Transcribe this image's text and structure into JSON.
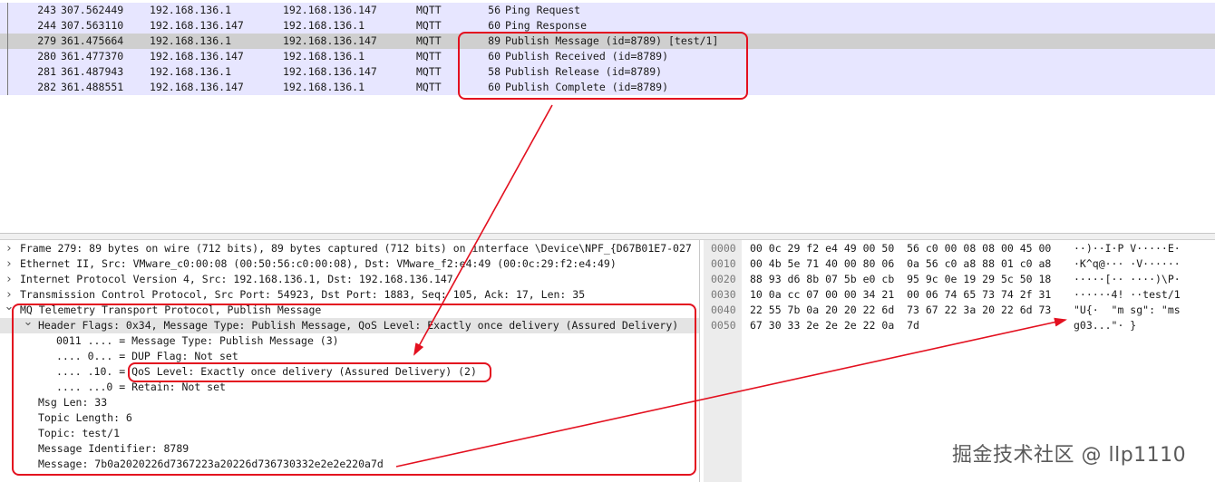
{
  "packets": [
    {
      "no": "243",
      "time": "307.562449",
      "src": "192.168.136.1",
      "dst": "192.168.136.147",
      "protocol": "MQTT",
      "length": "56",
      "info": "Ping Request",
      "selected": false
    },
    {
      "no": "244",
      "time": "307.563110",
      "src": "192.168.136.147",
      "dst": "192.168.136.1",
      "protocol": "MQTT",
      "length": "60",
      "info": "Ping Response",
      "selected": false
    },
    {
      "no": "279",
      "time": "361.475664",
      "src": "192.168.136.1",
      "dst": "192.168.136.147",
      "protocol": "MQTT",
      "length": "89",
      "info": "Publish Message (id=8789) [test/1]",
      "selected": true
    },
    {
      "no": "280",
      "time": "361.477370",
      "src": "192.168.136.147",
      "dst": "192.168.136.1",
      "protocol": "MQTT",
      "length": "60",
      "info": "Publish Received (id=8789)",
      "selected": false
    },
    {
      "no": "281",
      "time": "361.487943",
      "src": "192.168.136.1",
      "dst": "192.168.136.147",
      "protocol": "MQTT",
      "length": "58",
      "info": "Publish Release (id=8789)",
      "selected": false
    },
    {
      "no": "282",
      "time": "361.488551",
      "src": "192.168.136.147",
      "dst": "192.168.136.1",
      "protocol": "MQTT",
      "length": "60",
      "info": "Publish Complete (id=8789)",
      "selected": false
    }
  ],
  "details": [
    {
      "arrow": "collapsed",
      "text": "Frame 279: 89 bytes on wire (712 bits), 89 bytes captured (712 bits) on interface \\Device\\NPF_{D67B01E7-027"
    },
    {
      "arrow": "collapsed",
      "text": "Ethernet II, Src: VMware_c0:00:08 (00:50:56:c0:00:08), Dst: VMware_f2:e4:49 (00:0c:29:f2:e4:49)"
    },
    {
      "arrow": "collapsed",
      "text": "Internet Protocol Version 4, Src: 192.168.136.1, Dst: 192.168.136.147"
    },
    {
      "arrow": "collapsed",
      "text": "Transmission Control Protocol, Src Port: 54923, Dst Port: 1883, Seq: 105, Ack: 17, Len: 35"
    },
    {
      "arrow": "expanded",
      "text": "MQ Telemetry Transport Protocol, Publish Message"
    },
    {
      "arrow": "expanded",
      "text": "Header Flags: 0x34, Message Type: Publish Message, QoS Level: Exactly once delivery (Assured Delivery)",
      "highlight": true
    },
    {
      "arrow": "none",
      "text": "0011 .... = Message Type: Publish Message (3)"
    },
    {
      "arrow": "none",
      "text": ".... 0... = DUP Flag: Not set"
    },
    {
      "arrow": "none",
      "text": ".... .10. = QoS Level: Exactly once delivery (Assured Delivery) (2)"
    },
    {
      "arrow": "none",
      "text": ".... ...0 = Retain: Not set"
    },
    {
      "arrow": "none",
      "text": "Msg Len: 33"
    },
    {
      "arrow": "none",
      "text": "Topic Length: 6"
    },
    {
      "arrow": "none",
      "text": "Topic: test/1"
    },
    {
      "arrow": "none",
      "text": "Message Identifier: 8789"
    },
    {
      "arrow": "none",
      "text": "Message: 7b0a2020226d7367223a20226d736730332e2e2e220a7d"
    }
  ],
  "hex": [
    {
      "offset": "0000",
      "bytes": "00 0c 29 f2 e4 49 00 50  56 c0 00 08 08 00 45 00",
      "ascii": "··)··I·P V·····E·"
    },
    {
      "offset": "0010",
      "bytes": "00 4b 5e 71 40 00 80 06  0a 56 c0 a8 88 01 c0 a8",
      "ascii": "·K^q@··· ·V······"
    },
    {
      "offset": "0020",
      "bytes": "88 93 d6 8b 07 5b e0 cb  95 9c 0e 19 29 5c 50 18",
      "ascii": "·····[·· ····)\\P·"
    },
    {
      "offset": "0030",
      "bytes": "10 0a cc 07 00 00 34 21  00 06 74 65 73 74 2f 31",
      "ascii": "······4! ··test/1"
    },
    {
      "offset": "0040",
      "bytes": "22 55 7b 0a 20 20 22 6d  73 67 22 3a 20 22 6d 73",
      "ascii": "\"U{·  \"m sg\": \"ms"
    },
    {
      "offset": "0050",
      "bytes": "67 30 33 2e 2e 2e 22 0a  7d",
      "ascii": "g03...\"· }"
    }
  ],
  "icons": {
    "collapsed": "chevron-right-icon",
    "expanded": "chevron-down-icon"
  },
  "annotation_color": "#e3101f",
  "watermark": "掘金技术社区 @ llp1110"
}
